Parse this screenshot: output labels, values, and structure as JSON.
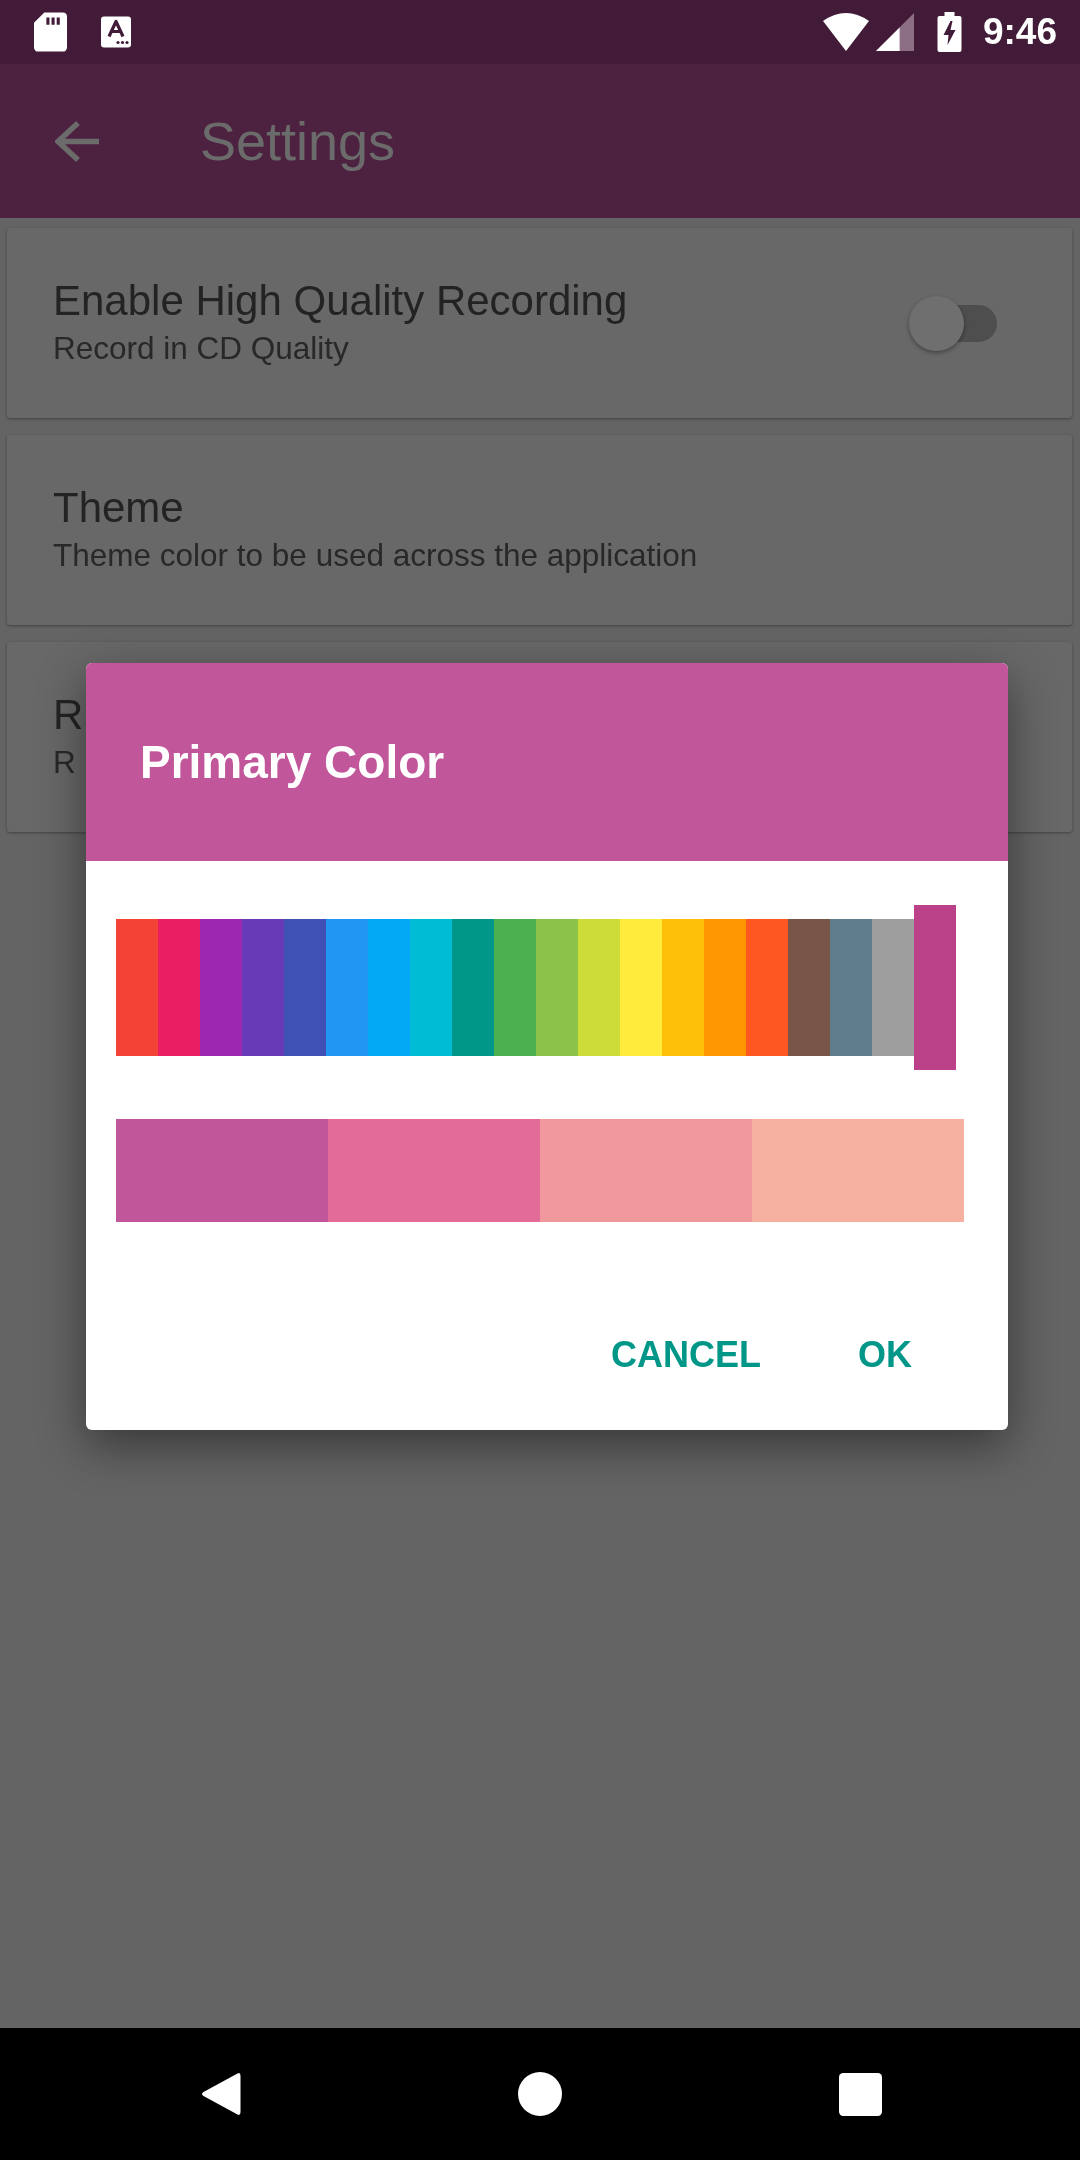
{
  "status_bar": {
    "time": "9:46"
  },
  "toolbar": {
    "title": "Settings"
  },
  "settings": [
    {
      "kind": "switch",
      "title": "Enable High Quality Recording",
      "summary": "Record in CD Quality",
      "checked": false
    },
    {
      "kind": "plain",
      "title": "Theme",
      "summary": "Theme color to be used across the application"
    },
    {
      "kind": "plain",
      "title": "R",
      "summary": "R"
    }
  ],
  "dialog": {
    "title": "Primary Color",
    "palette": [
      {
        "color": "#f44336",
        "selected": false
      },
      {
        "color": "#e91e63",
        "selected": false
      },
      {
        "color": "#9c27b0",
        "selected": false
      },
      {
        "color": "#673ab7",
        "selected": false
      },
      {
        "color": "#3f51b5",
        "selected": false
      },
      {
        "color": "#2196f3",
        "selected": false
      },
      {
        "color": "#03a9f4",
        "selected": false
      },
      {
        "color": "#00bcd4",
        "selected": false
      },
      {
        "color": "#009688",
        "selected": false
      },
      {
        "color": "#4caf50",
        "selected": false
      },
      {
        "color": "#8bc34a",
        "selected": false
      },
      {
        "color": "#cddc39",
        "selected": false
      },
      {
        "color": "#ffeb3b",
        "selected": false
      },
      {
        "color": "#ffc107",
        "selected": false
      },
      {
        "color": "#ff9800",
        "selected": false
      },
      {
        "color": "#ff5722",
        "selected": false
      },
      {
        "color": "#795548",
        "selected": false
      },
      {
        "color": "#607d8b",
        "selected": false
      },
      {
        "color": "#9e9e9e",
        "selected": false
      },
      {
        "color": "#bb4189",
        "selected": true
      }
    ],
    "shades": [
      {
        "color": "#c2569a"
      },
      {
        "color": "#e26b98"
      },
      {
        "color": "#f0989b"
      },
      {
        "color": "#f5b0a0"
      }
    ],
    "buttons": [
      "CANCEL",
      "OK"
    ]
  }
}
